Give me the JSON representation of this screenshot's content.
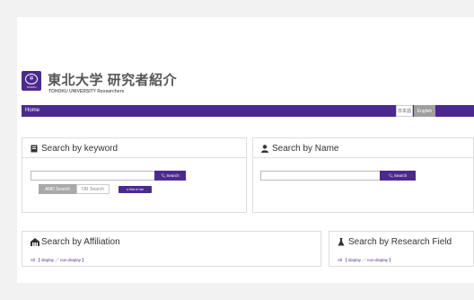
{
  "header": {
    "logo_text": "TOHOKU",
    "title": "東北大学 研究者紹介",
    "subtitle": "TOHOKU UNIVERSITY Researchers"
  },
  "nav": {
    "home": "Home",
    "lang_ja": "日本語",
    "lang_en": "English"
  },
  "keyword_panel": {
    "title": "Search by keyword",
    "icon": "book-icon",
    "search_button": "Search",
    "and_label": "AND Search",
    "or_label": "OR Search",
    "howto_label": "How to Use"
  },
  "name_panel": {
    "title": "Search by Name",
    "icon": "person-icon",
    "search_button": "Search"
  },
  "affiliation_panel": {
    "title": "Search by Affiliation",
    "icon": "building-icon",
    "filter_all": "All",
    "filter_display": "【 display ／ non-display 】"
  },
  "field_panel": {
    "title": "Search by Research Field",
    "icon": "flask-icon",
    "filter_all": "All",
    "filter_display": "【 display ／ non-display 】"
  },
  "colors": {
    "brand": "#4b2a8f",
    "toggle_active": "#a9a9a9"
  }
}
